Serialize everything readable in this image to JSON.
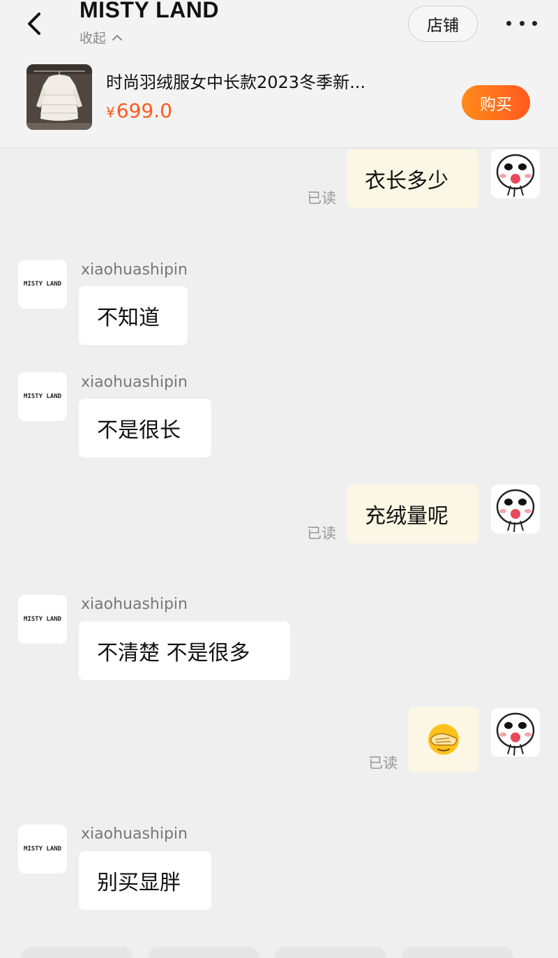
{
  "header": {
    "store_name": "MISTY LAND",
    "collapse_label": "收起",
    "shop_button": "店铺"
  },
  "product": {
    "name": "时尚羽绒服女中长款2023冬季新...",
    "currency": "¥",
    "price": "699.0",
    "buy_button": "购买"
  },
  "shop_avatar_text": "MISTY LAND",
  "colors": {
    "accent": "#ff5a1f",
    "out_bubble": "#fbf7e4",
    "in_bubble": "#ffffff",
    "background": "#efefef"
  },
  "messages": [
    {
      "from": "me",
      "text": "衣长多少",
      "status": "已读"
    },
    {
      "from": "shop",
      "sender": "xiaohuashipin",
      "text": "不知道"
    },
    {
      "from": "shop",
      "sender": "xiaohuashipin",
      "text": "不是很长"
    },
    {
      "from": "me",
      "text": "充绒量呢",
      "status": "已读"
    },
    {
      "from": "shop",
      "sender": "xiaohuashipin",
      "text": "不清楚 不是很多"
    },
    {
      "from": "me",
      "emoji": "facepalm-emoji",
      "status": "已读"
    },
    {
      "from": "shop",
      "sender": "xiaohuashipin",
      "text": "别买显胖"
    }
  ]
}
